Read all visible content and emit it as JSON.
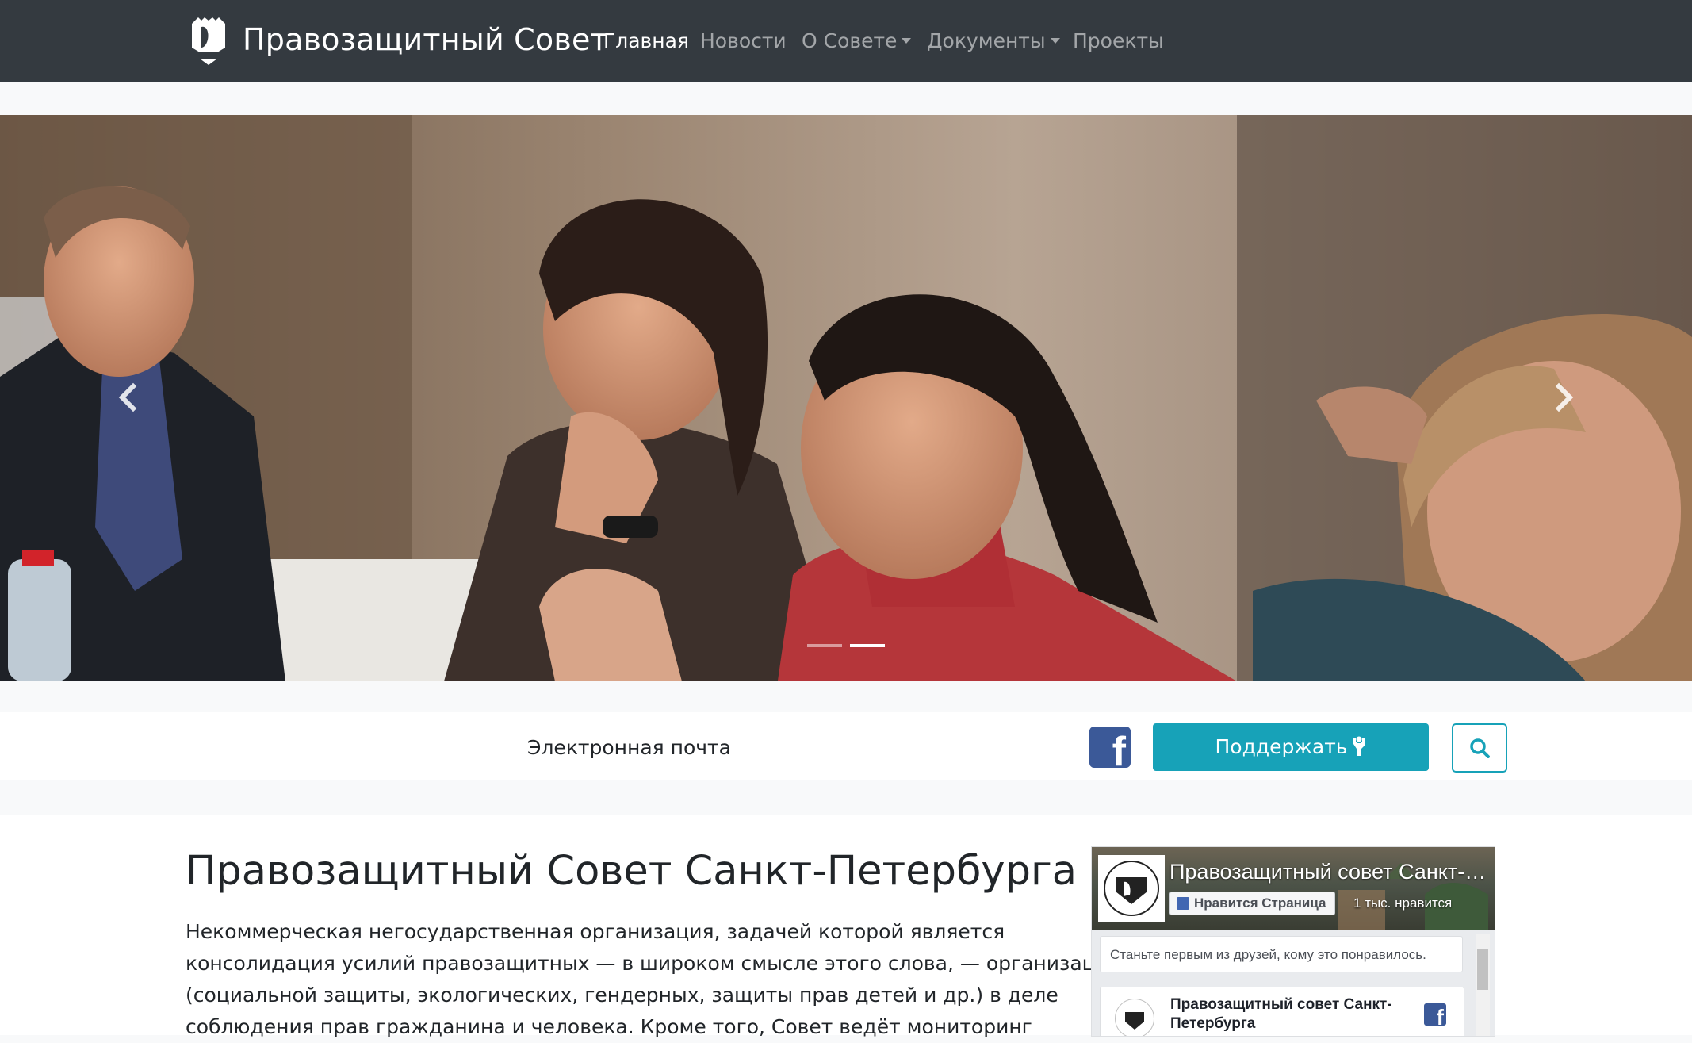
{
  "navbar": {
    "brand": "Правозащитный Совет",
    "links": [
      {
        "label": "Главная",
        "active": true
      },
      {
        "label": "Новости"
      },
      {
        "label": "О Совете",
        "dropdown": true
      },
      {
        "label": "Документы",
        "dropdown": true
      },
      {
        "label": "Проекты"
      }
    ],
    "icons": {
      "logo": "shield-logo-icon",
      "dropdown": "caret-down-icon"
    }
  },
  "carousel": {
    "slide_count": 2,
    "active_slide": 2,
    "icons": {
      "prev": "chevron-left-icon",
      "next": "chevron-right-icon"
    }
  },
  "info_strip": {
    "email_label": "Электронная почта",
    "donate_label": "Поддержать",
    "icons": {
      "facebook": "facebook-icon",
      "donate": "hand-raised-icon",
      "search": "search-icon"
    }
  },
  "main": {
    "title": "Правозащитный Совет Санкт-Петербурга",
    "intro_lines": [
      "Некоммерческая негосударственная организация, задачей которой является",
      "консолидация усилий правозащитных — в широком смысле этого слова, — организаций",
      "(социальной защиты, экологических, гендерных, защиты прав детей и др.) в деле",
      "соблюдения прав гражданина и человека. Кроме того, Совет ведёт мониторинг"
    ]
  },
  "facebook_widget": {
    "page_name": "Правозащитный совет Санкт-Петербурга",
    "like_label": "Нравится Страница",
    "likes_count": "1 тыс. нравится",
    "friends_text": "Станьте первым из друзей, кому это понравилось.",
    "post_author": "Правозащитный совет Санкт-Петербурга"
  },
  "colors": {
    "navbar_bg": "#343a40",
    "accent": "#17a2b8",
    "facebook": "#3b5998",
    "page_bg": "#f8f9fa"
  }
}
